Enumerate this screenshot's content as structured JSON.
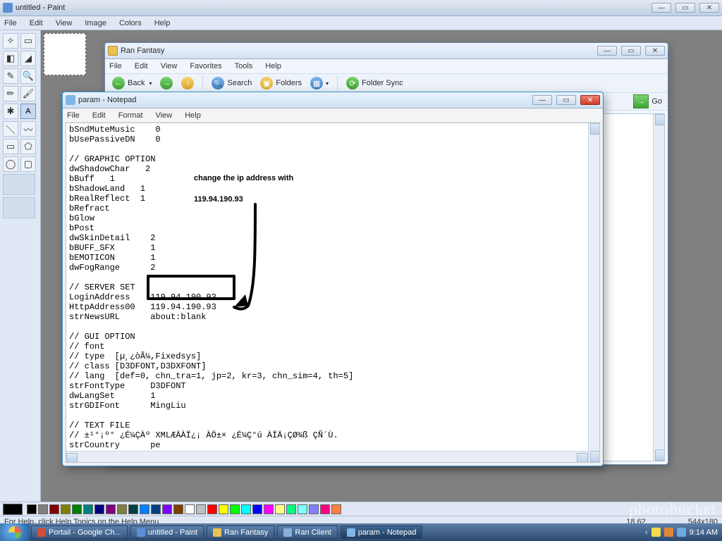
{
  "paint": {
    "title": "untitled - Paint",
    "menu": [
      "File",
      "Edit",
      "View",
      "Image",
      "Colors",
      "Help"
    ],
    "status_help": "For Help, click Help Topics on the Help Menu.",
    "status_pos": "18,62",
    "status_size": "544x180",
    "palette": [
      "#000000",
      "#808080",
      "#800000",
      "#808000",
      "#008000",
      "#008080",
      "#000080",
      "#800080",
      "#808040",
      "#004040",
      "#0080ff",
      "#004080",
      "#8000ff",
      "#804000",
      "#ffffff",
      "#c0c0c0",
      "#ff0000",
      "#ffff00",
      "#00ff00",
      "#00ffff",
      "#0000ff",
      "#ff00ff",
      "#ffff80",
      "#00ff80",
      "#80ffff",
      "#8080ff",
      "#ff0080",
      "#ff8040"
    ]
  },
  "explorer": {
    "title": "Ran Fantasy",
    "menu": [
      "File",
      "Edit",
      "View",
      "Favorites",
      "Tools",
      "Help"
    ],
    "toolbar": {
      "back": "Back",
      "search": "Search",
      "folders": "Folders",
      "sync": "Folder Sync"
    },
    "go": "Go"
  },
  "notepad": {
    "title": "param - Notepad",
    "menu": [
      "File",
      "Edit",
      "Format",
      "View",
      "Help"
    ],
    "content": "bSndMuteMusic    0\nbUsePassiveDN    0\n\n// GRAPHIC OPTION\ndwShadowChar   2\nbBuff   1\nbShadowLand   1\nbRealReflect  1\nbRefract\nbGlow\nbPost\ndwSkinDetail    2\nbBUFF_SFX       1\nbEMOTICON       1\ndwFogRange      2\n\n// SERVER SET\nLoginAddress    119.94.190.93\nHttpAddress00   119.94.190.93\nstrNewsURL      about:blank\n\n// GUI OPTION\n// font\n// type  [µ¸¿òÃ¼,Fixedsys]\n// class [D3DFONT,D3DXFONT]\n// lang  [def=0, chn_tra=1, jp=2, kr=3, chn_sim=4, th=5]\nstrFontType     D3DFONT\ndwLangSet       1\nstrGDIFont      MingLiu\n\n// TEXT FILE\n// ±¹°¡º° ¿É¼ÇÀº XMLÆÄÀÏ¿¡ ÀÖ±× ¿É¼Ç°ú ÀÏÄ¡ÇØ¾ß ÇÑ´Ù.\nstrCountry      pe\nstrGameInText   GameInText_pe.txt"
  },
  "annotation": {
    "line1": "change the ip address with",
    "line2": "119.94.190.93"
  },
  "taskbar": {
    "items": [
      {
        "label": "Portail - Google Ch...",
        "ico": "#d44b3a"
      },
      {
        "label": "untitled - Paint",
        "ico": "#5a8fd6"
      },
      {
        "label": "Ran Fantasy",
        "ico": "#e7c253"
      },
      {
        "label": "Ran Client",
        "ico": "#8bb0d8"
      },
      {
        "label": "param - Notepad",
        "ico": "#7fb6e8",
        "active": true
      }
    ],
    "clock": "9:14 AM"
  },
  "watermark": "photobucket"
}
